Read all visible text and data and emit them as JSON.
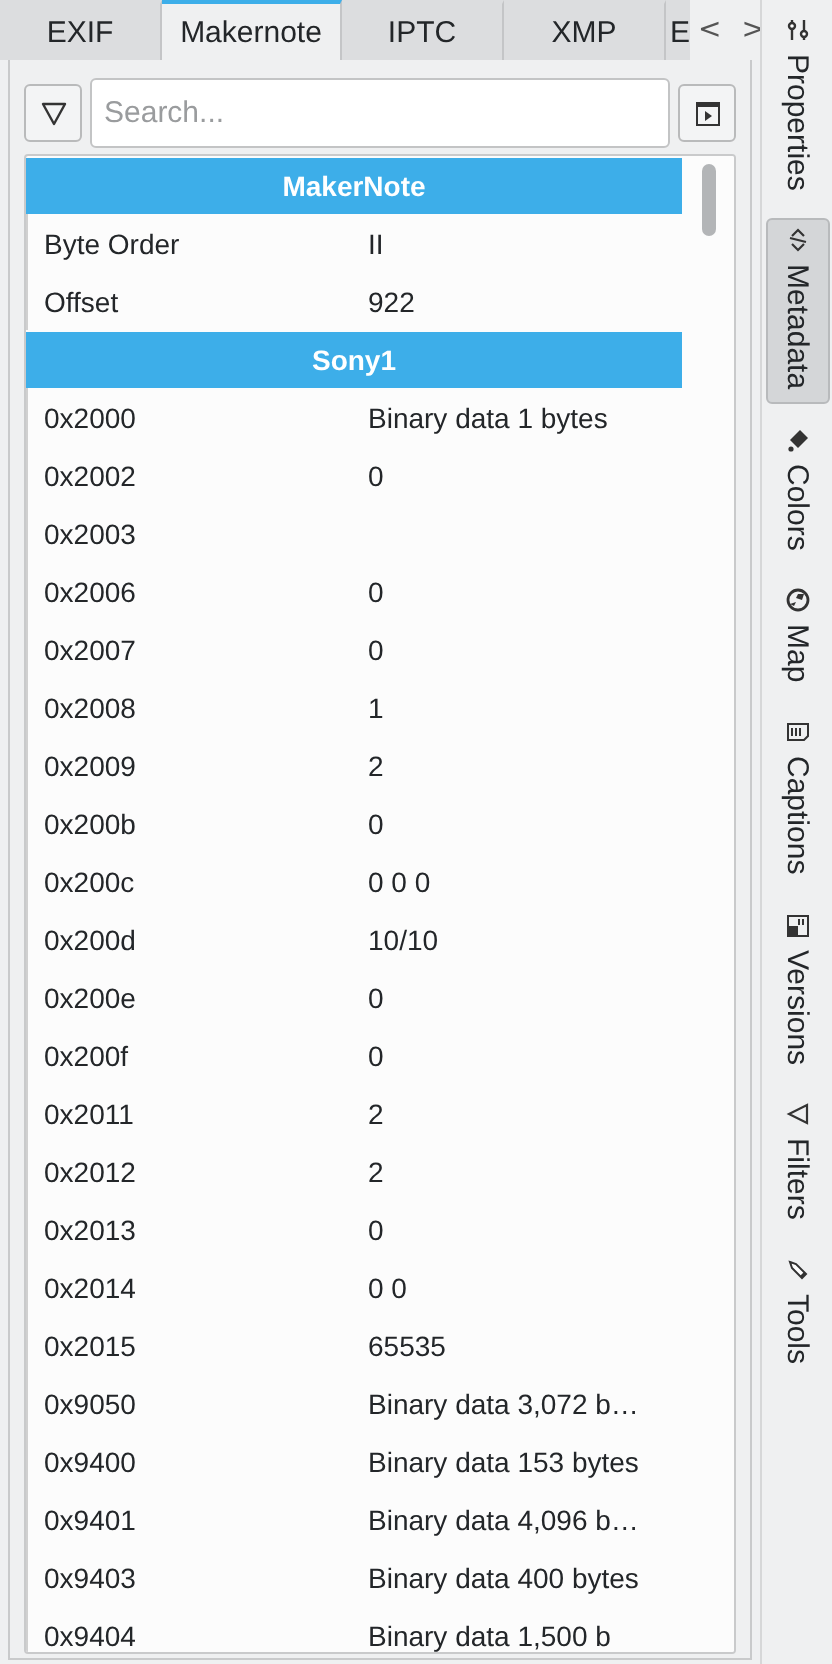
{
  "tabs": [
    {
      "label": "EXIF",
      "selected": false
    },
    {
      "label": "Makernote",
      "selected": true
    },
    {
      "label": "IPTC",
      "selected": false
    },
    {
      "label": "XMP",
      "selected": false
    },
    {
      "label": "E",
      "selected": false
    }
  ],
  "tab_scroll": {
    "left": "<",
    "right": ">"
  },
  "search": {
    "placeholder": "Search..."
  },
  "sections": [
    {
      "title": "MakerNote",
      "rows": [
        {
          "key": "Byte Order",
          "value": "II"
        },
        {
          "key": "Offset",
          "value": "922"
        }
      ]
    },
    {
      "title": "Sony1",
      "rows": [
        {
          "key": "0x2000",
          "value": "Binary data 1 bytes"
        },
        {
          "key": "0x2002",
          "value": "0"
        },
        {
          "key": "0x2003"
        },
        {
          "key": "0x2006",
          "value": "0"
        },
        {
          "key": "0x2007",
          "value": "0"
        },
        {
          "key": "0x2008",
          "value": "1"
        },
        {
          "key": "0x2009",
          "value": "2"
        },
        {
          "key": "0x200b",
          "value": "0"
        },
        {
          "key": "0x200c",
          "value": "0 0 0"
        },
        {
          "key": "0x200d",
          "value": "10/10"
        },
        {
          "key": "0x200e",
          "value": "0"
        },
        {
          "key": "0x200f",
          "value": "0"
        },
        {
          "key": "0x2011",
          "value": "2"
        },
        {
          "key": "0x2012",
          "value": "2"
        },
        {
          "key": "0x2013",
          "value": "0"
        },
        {
          "key": "0x2014",
          "value": "0 0"
        },
        {
          "key": "0x2015",
          "value": "65535"
        },
        {
          "key": "0x9050",
          "value": "Binary data 3,072 b…"
        },
        {
          "key": "0x9400",
          "value": "Binary data 153 bytes"
        },
        {
          "key": "0x9401",
          "value": "Binary data 4,096 b…"
        },
        {
          "key": "0x9403",
          "value": "Binary data 400 bytes"
        },
        {
          "key": "0x9404",
          "value": "Binary data 1,500 b"
        }
      ]
    }
  ],
  "sidebar": {
    "items": [
      {
        "label": "Properties",
        "kind": "sliders",
        "selected": false
      },
      {
        "label": "Metadata",
        "kind": "code",
        "selected": true
      },
      {
        "label": "Colors",
        "kind": "bucket",
        "selected": false
      },
      {
        "label": "Map",
        "kind": "globe",
        "selected": false
      },
      {
        "label": "Captions",
        "kind": "document",
        "selected": false
      },
      {
        "label": "Versions",
        "kind": "versions",
        "selected": false
      },
      {
        "label": "Filters",
        "kind": "filter",
        "selected": false
      },
      {
        "label": "Tools",
        "kind": "pencil",
        "selected": false
      }
    ]
  }
}
